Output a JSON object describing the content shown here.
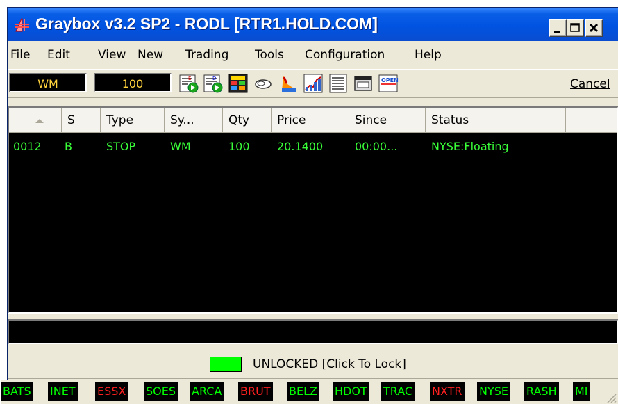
{
  "window": {
    "title": "Graybox v3.2 SP2 - RODL [RTR1.HOLD.COM]"
  },
  "menu": [
    "File",
    "Edit",
    "View",
    "New",
    "Trading",
    "Tools",
    "Configuration",
    "Help"
  ],
  "toolbar": {
    "symbol": "WM",
    "quantity": "100",
    "buttons": [
      "buy-order-icon",
      "sell-order-icon",
      "montage-icon",
      "handshake-icon",
      "alert-icon",
      "chart-icon",
      "list-icon",
      "window-icon",
      "open-icon"
    ],
    "open_label": "OPEN",
    "cancel_label": "Cancel"
  },
  "grid": {
    "headers": [
      "S",
      "Type",
      "Sy...",
      "Qty",
      "Price",
      "Since",
      "Status"
    ],
    "rows": [
      {
        "id": "0012",
        "side": "B",
        "type": "STOP",
        "symbol": "WM",
        "qty": "100",
        "price": "20.1400",
        "since": "00:00...",
        "status": "NYSE:Floating"
      }
    ]
  },
  "lock": {
    "label": "UNLOCKED [Click To Lock]",
    "color": "#00ff00"
  },
  "exchanges": [
    {
      "name": "BATS",
      "color": "#00ff00"
    },
    {
      "name": "INET",
      "color": "#00ff00"
    },
    {
      "name": "ESSX",
      "color": "#ff2020"
    },
    {
      "name": "SOES",
      "color": "#00ff00"
    },
    {
      "name": "ARCA",
      "color": "#00ff00"
    },
    {
      "name": "BRUT",
      "color": "#ff2020"
    },
    {
      "name": "BELZ",
      "color": "#00ff00"
    },
    {
      "name": "HDOT",
      "color": "#00ff00"
    },
    {
      "name": "TRAC",
      "color": "#00ff00"
    },
    {
      "name": "NXTR",
      "color": "#ff2020"
    },
    {
      "name": "NYSE",
      "color": "#00ff00"
    },
    {
      "name": "RASH",
      "color": "#00ff00"
    },
    {
      "name": "MI",
      "color": "#00ff00"
    }
  ]
}
